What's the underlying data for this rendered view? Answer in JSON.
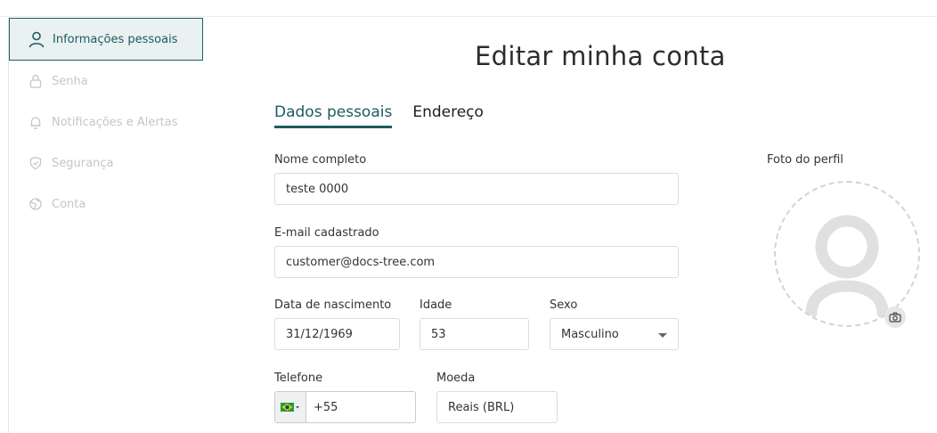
{
  "sidebar": {
    "items": [
      {
        "label": "Informações pessoais",
        "icon": "user-icon",
        "active": true
      },
      {
        "label": "Senha",
        "icon": "lock-icon",
        "active": false
      },
      {
        "label": "Notificações e Alertas",
        "icon": "bell-icon",
        "active": false
      },
      {
        "label": "Segurança",
        "icon": "shield-icon",
        "active": false
      },
      {
        "label": "Conta",
        "icon": "globe-icon",
        "active": false
      }
    ]
  },
  "page": {
    "title": "Editar minha conta"
  },
  "tabs": [
    {
      "label": "Dados pessoais",
      "active": true
    },
    {
      "label": "Endereço",
      "active": false
    }
  ],
  "form": {
    "full_name": {
      "label": "Nome completo",
      "value": "teste 0000"
    },
    "email": {
      "label": "E-mail cadastrado",
      "value": "customer@docs-tree.com"
    },
    "birth_date": {
      "label": "Data de nascimento",
      "value": "31/12/1969"
    },
    "age": {
      "label": "Idade",
      "value": "53"
    },
    "sex": {
      "label": "Sexo",
      "value": "Masculino"
    },
    "phone": {
      "label": "Telefone",
      "value": "+55",
      "country_flag": "brazil-flag-icon"
    },
    "currency": {
      "label": "Moeda",
      "value": "Reais (BRL)"
    }
  },
  "profile_photo": {
    "label": "Foto do perfil",
    "placeholder_icon": "user-silhouette-icon",
    "action_icon": "camera-icon"
  },
  "colors": {
    "accent": "#1d5b5e",
    "active_bg": "#e9f1f1",
    "muted": "#c3c6c8",
    "border": "#d9dcde"
  }
}
